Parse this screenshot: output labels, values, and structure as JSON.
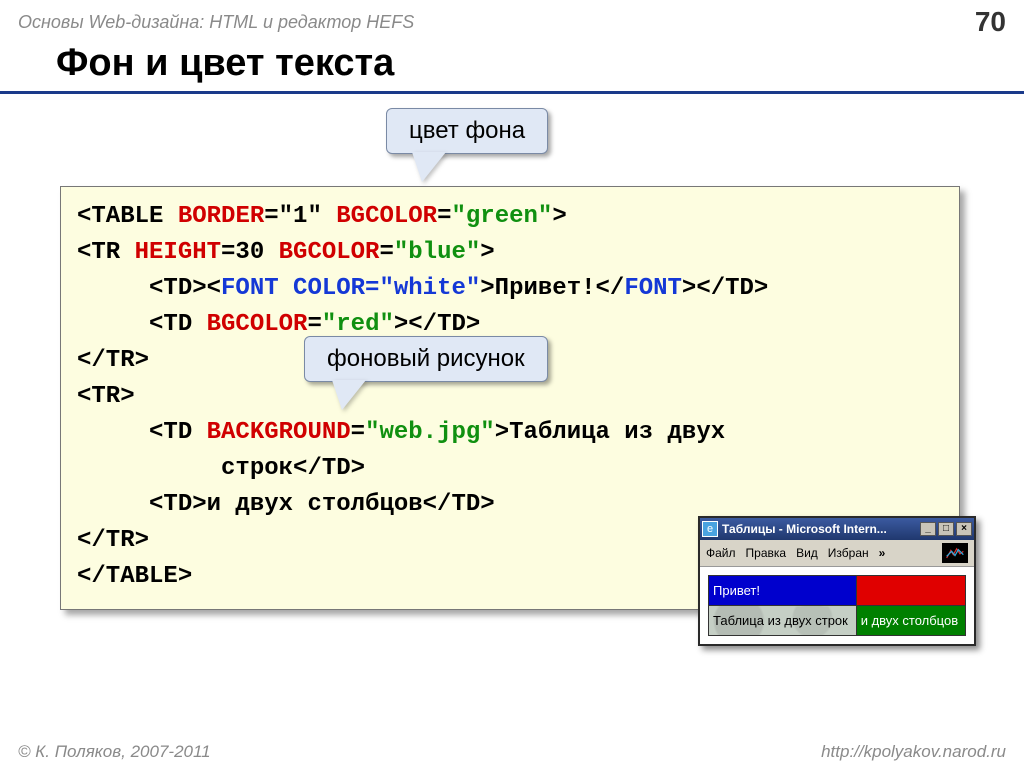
{
  "header": {
    "subject": "Основы Web-дизайна: HTML и редактор HEFS",
    "page_num": "70"
  },
  "title": "Фон и цвет текста",
  "callouts": {
    "bg_color": "цвет фона",
    "bg_image": "фоновый рисунок"
  },
  "code": {
    "l1a": "<TABLE ",
    "l1b": "BORDER",
    "l1c": "=\"1\" ",
    "l1d": "BGCOLOR",
    "l1e": "=",
    "l1f": "\"green\"",
    "l1g": ">",
    "l2a": "<TR ",
    "l2b": "HEIGHT",
    "l2c": "=30 ",
    "l2d": "BGCOLOR",
    "l2e": "=",
    "l2f": "\"blue\"",
    "l2g": ">",
    "l3a": "     <TD><",
    "l3b": "FONT COLOR=\"white\"",
    "l3c": ">Привет!</",
    "l3d": "FONT",
    "l3e": "></TD>",
    "l4a": "     <TD ",
    "l4b": "BGCOLOR",
    "l4c": "=",
    "l4d": "\"red\"",
    "l4e": "></TD>",
    "l5": "</TR>",
    "l6": "<TR>",
    "l7a": "     <TD ",
    "l7b": "BACKGROUND",
    "l7c": "=",
    "l7d": "\"web.jpg\"",
    "l7e": ">Таблица из двух",
    "l8": "          строк</TD>",
    "l9": "     <TD>и двух столбцов</TD>",
    "l10": "</TR>",
    "l11": "</TABLE>"
  },
  "browser": {
    "title": "Таблицы - Microsoft Intern...",
    "menu": {
      "file": "Файл",
      "edit": "Правка",
      "view": "Вид",
      "fav": "Избран",
      "more": "»"
    },
    "cells": {
      "c1": "Привет!",
      "c2": "",
      "c3": "Таблица из двух строк",
      "c4": "и двух столбцов"
    }
  },
  "footer": {
    "left": "© К. Поляков, 2007-2011",
    "right": "http://kpolyakov.narod.ru"
  }
}
